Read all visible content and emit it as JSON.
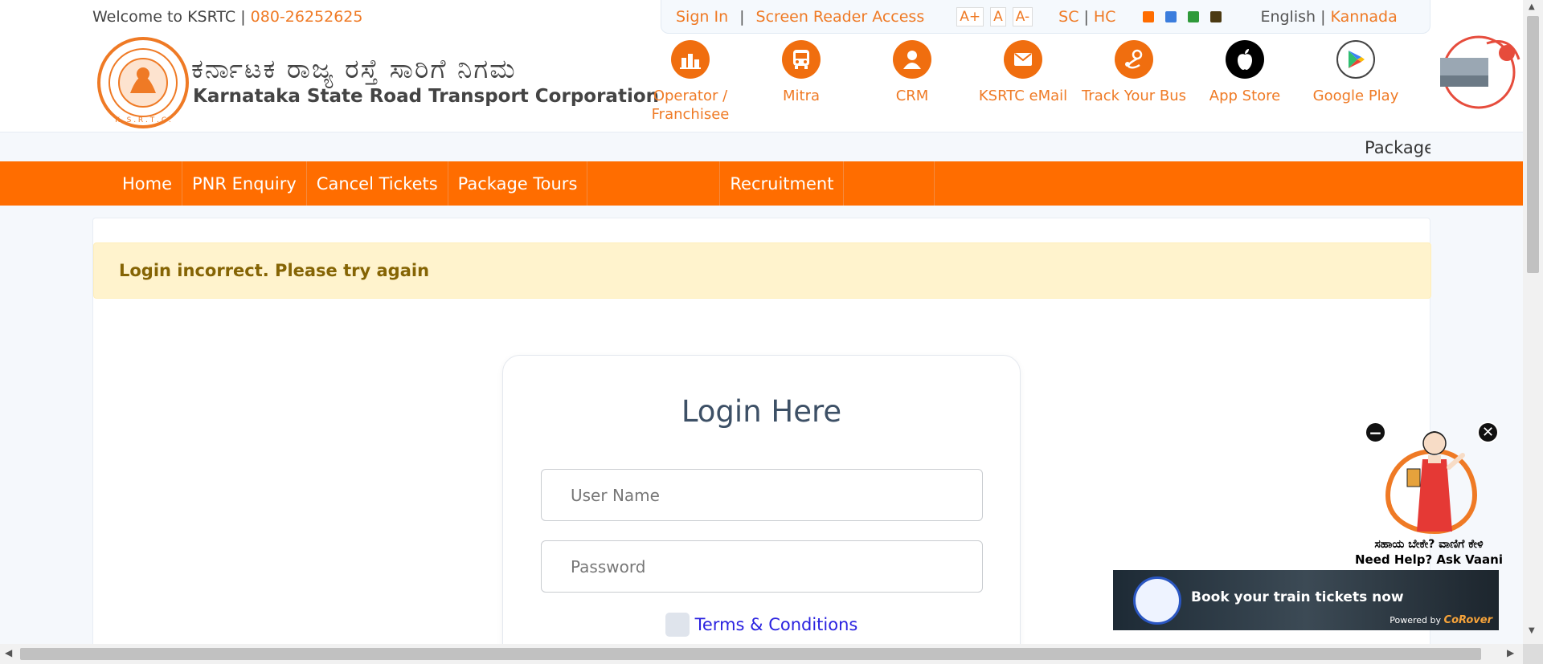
{
  "header": {
    "welcome_text": "Welcome to KSRTC | ",
    "phone": "080-26252625",
    "logo_kannada": "ಕರ್ನಾಟಕ ರಾಜ್ಯ ರಸ್ತೆ ಸಾರಿಗೆ ನಿಗಮ",
    "logo_english": "Karnataka State Road Transport Corporation",
    "logo_ring_text": "K . S . R . T . C ."
  },
  "access_bar": {
    "sign_in": "Sign In",
    "separator": "|",
    "screen_reader": "Screen Reader Access",
    "font_increase": "A+",
    "font_normal": "A",
    "font_decrease": "A-",
    "sc": "SC",
    "pipe": "|",
    "hc": "HC",
    "theme_colors": [
      "#ff6d00",
      "#3b7ddd",
      "#2f9a3a",
      "#4b3a12"
    ],
    "lang_english": "English",
    "lang_separator": " | ",
    "lang_kannada": "Kannada"
  },
  "quick_links": [
    {
      "label": "Operator / Franchisee",
      "icon": "building-icon"
    },
    {
      "label": "Mitra",
      "icon": "bus-icon"
    },
    {
      "label": "CRM",
      "icon": "user-icon"
    },
    {
      "label": "KSRTC eMail",
      "icon": "mail-icon"
    },
    {
      "label": "Track Your Bus",
      "icon": "route-pin-icon"
    },
    {
      "label": "App Store",
      "icon": "apple-icon"
    },
    {
      "label": "Google Play",
      "icon": "play-store-icon"
    }
  ],
  "marquee_text": "Package",
  "nav": {
    "items": [
      "Home",
      "PNR Enquiry",
      "Cancel Tickets",
      "Package Tours",
      "",
      "Recruitment",
      ""
    ]
  },
  "alert": {
    "message": "Login incorrect. Please try again"
  },
  "login": {
    "title": "Login Here",
    "username_placeholder": "User Name",
    "password_placeholder": "Password",
    "terms_label": "Terms & Conditions"
  },
  "vaani": {
    "help_kannada": "ಸಹಾಯ ಬೇಕೇ? ವಾಣಿಗೆ ಕೇಳಿ",
    "help_english": "Need Help? Ask Vaani",
    "minimize_icon": "minus-icon",
    "close_icon": "close-icon"
  },
  "train_banner": {
    "text": "Book your train tickets now",
    "powered_label": "Powered by ",
    "powered_brand": "CoRover"
  }
}
